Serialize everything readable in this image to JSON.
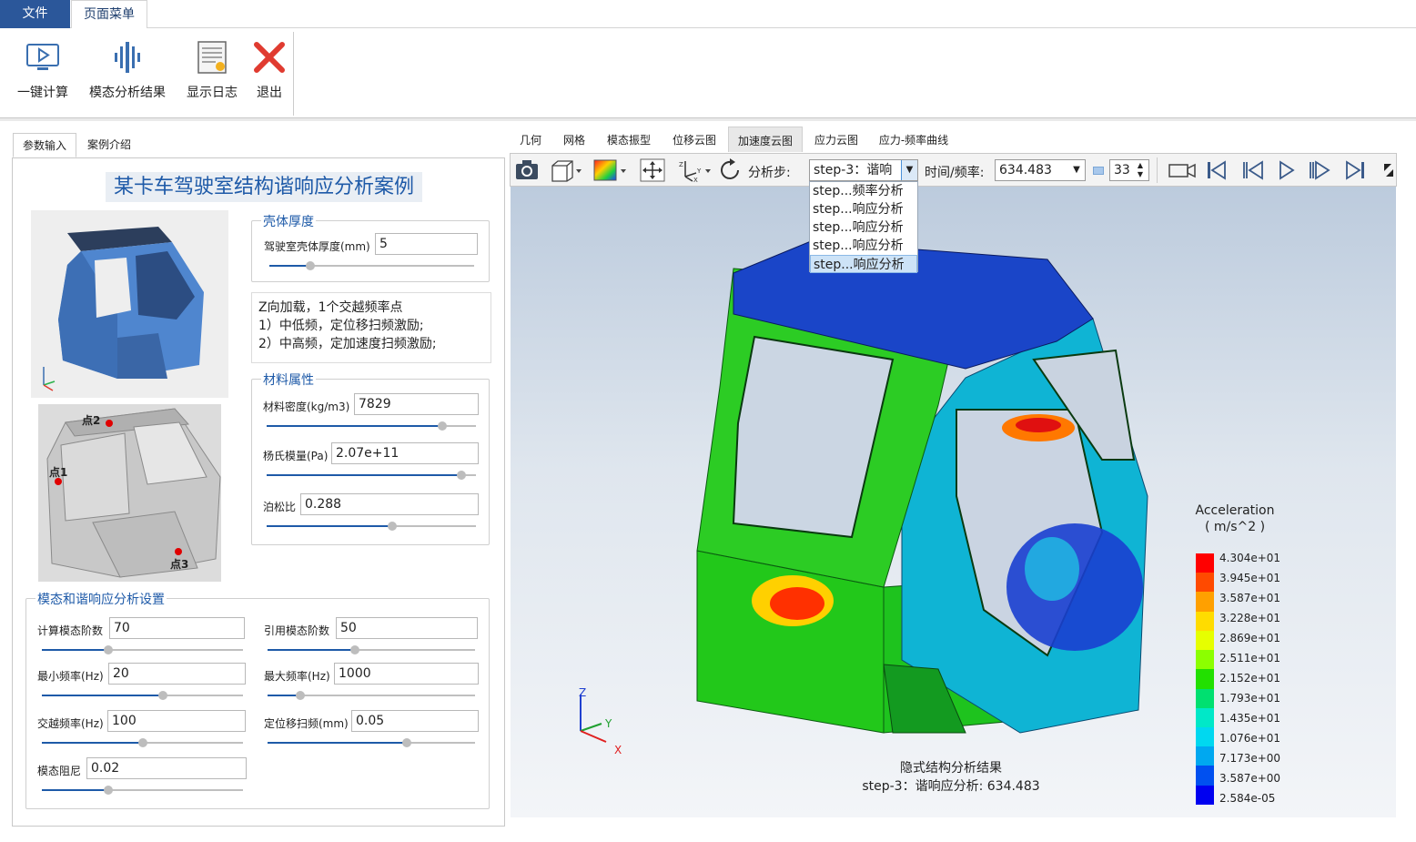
{
  "ribbon": {
    "tabs": [
      "文件",
      "页面菜单"
    ],
    "buttons": [
      "一键计算",
      "模态分析结果",
      "显示日志",
      "退出"
    ]
  },
  "left_tabs": [
    "参数输入",
    "案例介绍"
  ],
  "title": "某卡车驾驶室结构谐响应分析案例",
  "point_labels": [
    "点2",
    "点1",
    "点3"
  ],
  "shell": {
    "group_title": "壳体厚度",
    "thickness_label": "驾驶室壳体厚度(mm)",
    "thickness_value": "5",
    "thickness_slider": 0.2
  },
  "description": [
    "Z向加载，1个交越频率点",
    "1）中低频，定位移扫频激励;",
    "2）中高频，定加速度扫频激励;"
  ],
  "material": {
    "group_title": "材料属性",
    "density_label": "材料密度(kg/m3)",
    "density_value": "7829",
    "density_slider": 0.84,
    "modulus_label": "杨氏模量(Pa)",
    "modulus_value": "2.07e+11",
    "modulus_slider": 0.93,
    "poisson_label": "泊松比",
    "poisson_value": "0.288",
    "poisson_slider": 0.6
  },
  "analysis": {
    "group_title": "模态和谐响应分析设置",
    "modes_label": "计算模态阶数",
    "modes_value": "70",
    "modes_slider": 0.33,
    "ref_modes_label": "引用模态阶数",
    "ref_modes_value": "50",
    "ref_modes_slider": 0.42,
    "fmin_label": "最小频率(Hz)",
    "fmin_value": "20",
    "fmin_slider": 0.6,
    "fmax_label": "最大频率(Hz)",
    "fmax_value": "1000",
    "fmax_slider": 0.16,
    "cross_label": "交越频率(Hz)",
    "cross_value": "100",
    "cross_slider": 0.5,
    "disp_label": "定位移扫频(mm)",
    "disp_value": "0.05",
    "disp_slider": 0.67,
    "damping_label": "模态阻尼",
    "damping_value": "0.02",
    "damping_slider": 0.33
  },
  "view_tabs": [
    "几何",
    "网格",
    "模态振型",
    "位移云图",
    "加速度云图",
    "应力云图",
    "应力-频率曲线"
  ],
  "active_view_tab": "加速度云图",
  "toolbar": {
    "step_label": "分析步:",
    "step_value": "step-3：谐响",
    "time_label": "时间/频率:",
    "time_value": "634.483",
    "frame_value": "33"
  },
  "step_options": [
    "step...频率分析",
    "step...响应分析",
    "step...响应分析",
    "step...响应分析",
    "step...响应分析"
  ],
  "legend": {
    "title_line1": "Acceleration",
    "title_line2": "( m/s^2 )",
    "labels": [
      "4.304e+01",
      "3.945e+01",
      "3.587e+01",
      "3.228e+01",
      "2.869e+01",
      "2.511e+01",
      "2.152e+01",
      "1.793e+01",
      "1.435e+01",
      "1.076e+01",
      "7.173e+00",
      "3.587e+00",
      "2.584e-05"
    ],
    "colors": [
      "#ff0000",
      "#ff4a00",
      "#ffa000",
      "#ffdc00",
      "#e6ff00",
      "#8cff00",
      "#22e000",
      "#00e070",
      "#00e8c8",
      "#00d8f0",
      "#00a8f0",
      "#0050f0",
      "#0000f0"
    ]
  },
  "axes": {
    "z": "Z",
    "y": "Y",
    "x": "X"
  },
  "viewport_caption": {
    "line1": "隐式结构分析结果",
    "line2": "step-3：谐响应分析: 634.483"
  }
}
